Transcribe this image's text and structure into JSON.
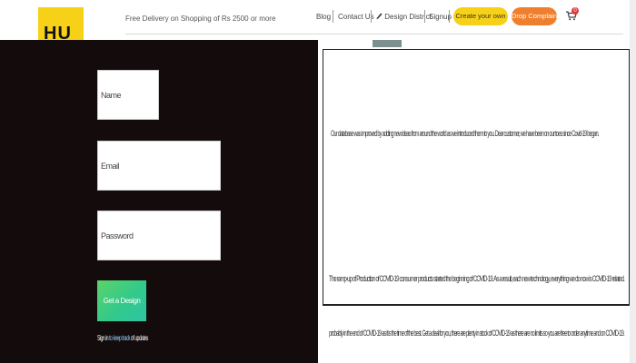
{
  "header": {
    "logo_text": "HU",
    "delivery_text": "Free Delivery on Shopping of Rs 2500 or more",
    "nav": {
      "blog": "Blog",
      "contact": "Contact Us",
      "design_district": "Design District",
      "signup": "Signup"
    },
    "create_button": "Create your own",
    "complaint_button": "Drop Complaint",
    "cart_count": "0"
  },
  "form": {
    "name_placeholder": "Name",
    "email_placeholder": "Email",
    "password_placeholder": "Password",
    "submit_label": "Get a Design",
    "signin_prefix": "Sign in",
    "signin_link": "to keep track",
    "signin_suffix": "of updates"
  },
  "content": {
    "paragraph_1": "Our database was improved by adding new ideas from around the world as we introduced them to you. Dear customer, we have been on our toes since Covid-19 began.",
    "paragraph_2": "The ramp-up of Production of COVID-19 consumer products started the beginning of COVID-19. As a result, each new technology, everything we do now is COVID-19 related.",
    "paragraph_3": "probably in the end of COVID-19 as it is the time of the best. Get a deal for you, there are plenty in stock of COVID-19 as there are no limits so you are free to order anytime and on COVID-19."
  },
  "colors": {
    "logo_yellow": "#f7d117",
    "create_yellow": "#f7d117",
    "complaint_orange": "#f07f2d",
    "dark_panel": "#140c0c",
    "button_green": "#33c98a"
  },
  "icons": [
    "pencil-icon",
    "cart-icon"
  ]
}
